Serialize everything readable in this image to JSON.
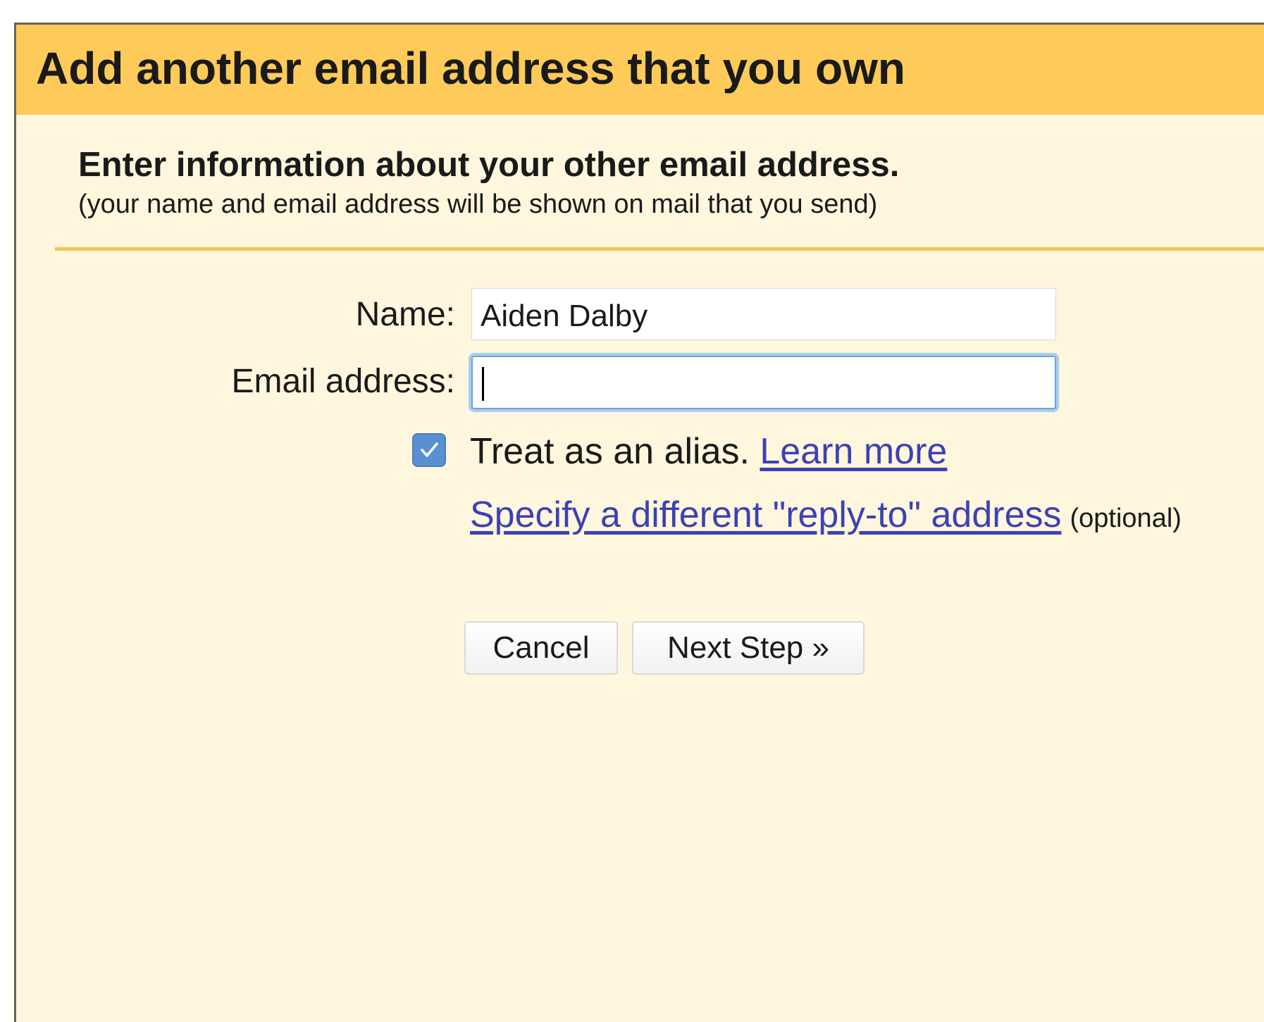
{
  "dialog": {
    "title": "Add another email address that you own",
    "heading": "Enter information about your other email address.",
    "subheading": "(your name and email address will be shown on mail that you send)"
  },
  "form": {
    "name_label": "Name:",
    "name_value": "Aiden Dalby",
    "email_label": "Email address:",
    "email_value": "",
    "alias_checked": true,
    "alias_label": "Treat as an alias.",
    "learn_more_link": "Learn more",
    "reply_to_link": "Specify a different \"reply-to\" address",
    "reply_to_note": "(optional)"
  },
  "buttons": {
    "cancel": "Cancel",
    "next": "Next Step »"
  },
  "icons": {
    "checkbox": "checkmark-icon"
  },
  "colors": {
    "title_bar": "#fecb5a",
    "panel_background": "#fef6dd",
    "divider": "#f5c451",
    "link": "#3c41b6",
    "checkbox": "#5b8fd3",
    "focus_ring": "#a9cdf0"
  }
}
